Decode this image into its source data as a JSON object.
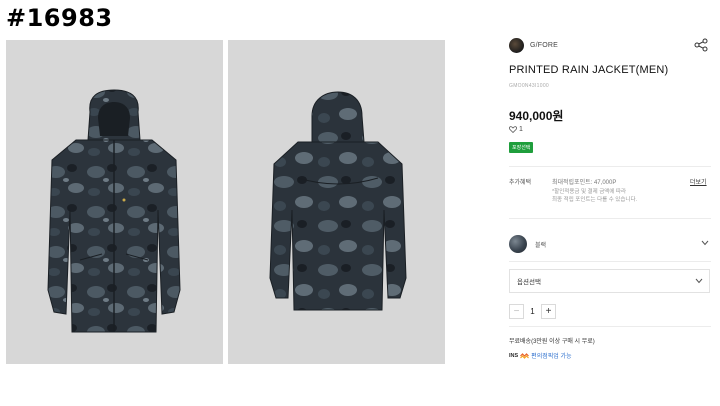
{
  "post": {
    "id": "#16983"
  },
  "gallery": {
    "front_alt": "jacket-front-photo",
    "back_alt": "jacket-back-photo"
  },
  "brand": {
    "name": "G/FORE"
  },
  "product": {
    "name": "PRINTED RAIN JACKET(MEN)",
    "code": "GMO0N43I1000",
    "price": "940,000원",
    "likes": "1",
    "badge": "포장선택"
  },
  "benefits": {
    "label": "추가혜택",
    "title": "최대적립포인트: 47,000P",
    "more": "더보기",
    "note_line1": "*할인적용금 및 결제 금액에 따라",
    "note_line2": "최종 적립 포인트는 다를 수 있습니다."
  },
  "color": {
    "name": "블랙"
  },
  "option": {
    "placeholder": "옵션선택"
  },
  "quantity": {
    "value": "1",
    "minus": "−",
    "plus": "+"
  },
  "shipping": {
    "text": "무료배송(3만원 이상 구매 시 무료)"
  },
  "delivery": {
    "tag": "INS",
    "label": "편의점픽업 가능"
  },
  "colors": {
    "badge": "#1f9e3c",
    "link": "#2c6fce",
    "jacket_base": "#2c343c"
  }
}
